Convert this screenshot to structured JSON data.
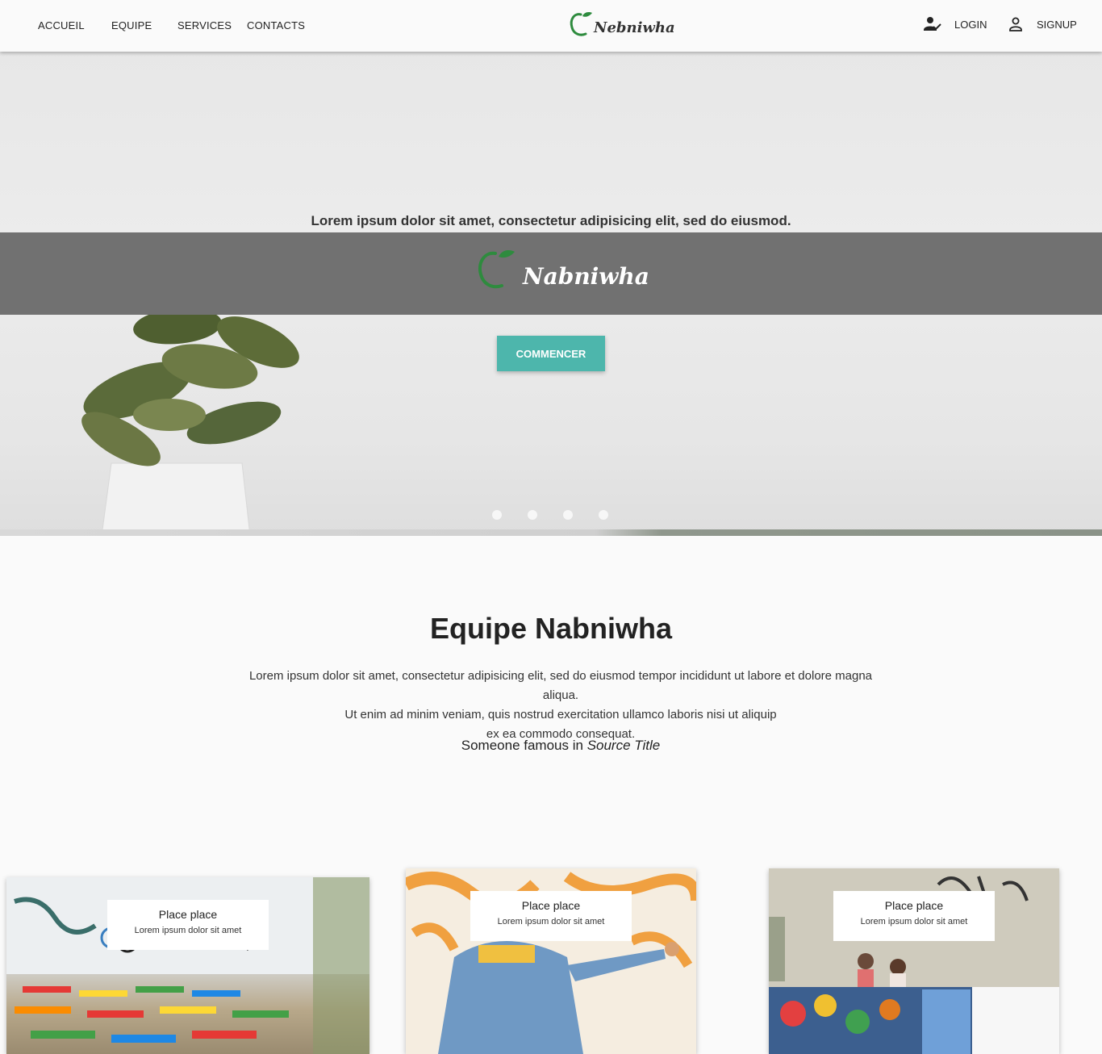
{
  "nav": {
    "items": [
      "ACCUEIL",
      "EQUIPE",
      "SERVICES",
      "CONTACTS"
    ],
    "brand": "Nebniwha",
    "login": "LOGIN",
    "signup": "SIGNUP"
  },
  "hero": {
    "tagline": "Lorem ipsum dolor sit amet, consectetur adipisicing elit, sed do eiusmod.",
    "brand": "Nabniwha",
    "cta": "COMMENCER",
    "slides": 4,
    "active_slide": 0
  },
  "team": {
    "title": "Equipe Nabniwha",
    "text_lines": [
      "Lorem ipsum dolor sit amet, consectetur adipisicing elit, sed do eiusmod tempor incididunt ut labore et dolore magna aliqua.",
      "Ut enim ad minim veniam, quis nostrud exercitation ullamco laboris nisi ut aliquip",
      "ex ea commodo consequat."
    ],
    "quote_prefix": "Someone famous in",
    "quote_source": "Source Title"
  },
  "cards": [
    {
      "title": "Place place",
      "subtitle": "Lorem ipsum dolor sit amet"
    },
    {
      "title": "Place place",
      "subtitle": "Lorem ipsum dolor sit amet"
    },
    {
      "title": "Place place",
      "subtitle": "Lorem ipsum dolor sit amet"
    }
  ],
  "colors": {
    "accent": "#4db6ac",
    "band": "#717171",
    "logo_green": "#2e8b3e"
  }
}
